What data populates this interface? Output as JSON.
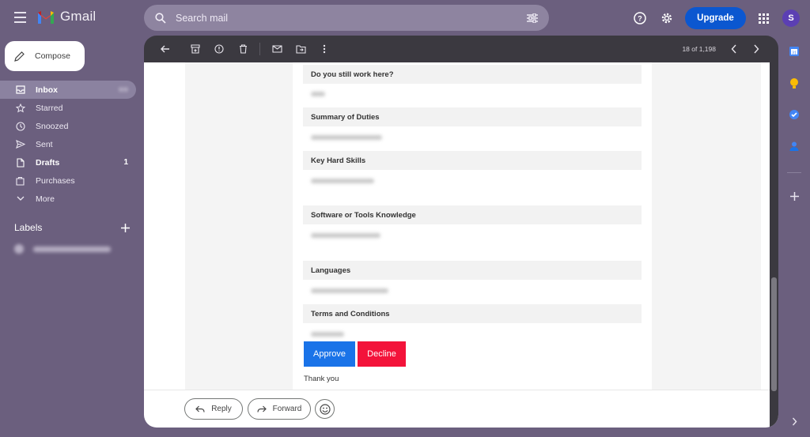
{
  "app": {
    "name": "Gmail"
  },
  "search": {
    "placeholder": "Search mail"
  },
  "header": {
    "upgrade_label": "Upgrade",
    "avatar_initial": "S"
  },
  "sidebar": {
    "compose_label": "Compose",
    "items": [
      {
        "label": "Inbox",
        "count": "",
        "icon": "inbox-icon"
      },
      {
        "label": "Starred",
        "count": "",
        "icon": "star-icon"
      },
      {
        "label": "Snoozed",
        "count": "",
        "icon": "clock-icon"
      },
      {
        "label": "Sent",
        "count": "",
        "icon": "send-icon"
      },
      {
        "label": "Drafts",
        "count": "1",
        "icon": "draft-icon"
      },
      {
        "label": "Purchases",
        "count": "",
        "icon": "purchases-icon"
      },
      {
        "label": "More",
        "count": "",
        "icon": "chevron-down-icon"
      }
    ],
    "labels_heading": "Labels"
  },
  "toolbar": {
    "pager": "18 of 1,198"
  },
  "email": {
    "fields": [
      {
        "question": "Do you still work here?"
      },
      {
        "question": "Summary of Duties"
      },
      {
        "question": "Key Hard Skills"
      },
      {
        "question": "Software or Tools Knowledge"
      },
      {
        "question": "Languages"
      },
      {
        "question": "Terms and Conditions"
      }
    ],
    "approve_label": "Approve",
    "decline_label": "Decline",
    "closing": "Thank you"
  },
  "actions": {
    "reply_label": "Reply",
    "forward_label": "Forward"
  },
  "colors": {
    "accent": "#0b57d0",
    "approve": "#1a73e8",
    "decline": "#f3133a",
    "background": "#6b5f7e"
  }
}
